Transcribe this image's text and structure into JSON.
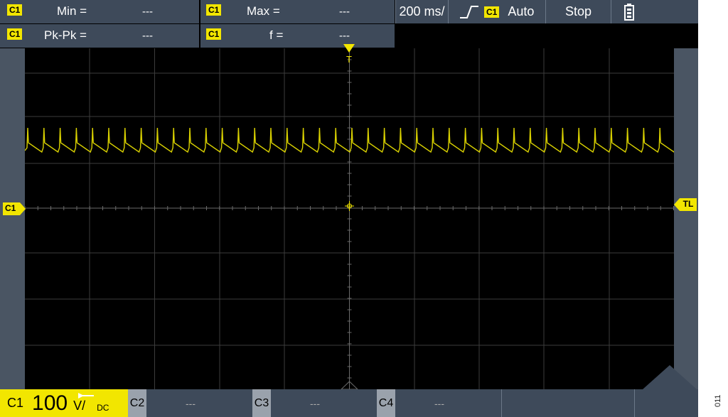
{
  "measurements": [
    {
      "channel": "C1",
      "label": "Min =",
      "value": "---"
    },
    {
      "channel": "C1",
      "label": "Max =",
      "value": "---"
    },
    {
      "channel": "C1",
      "label": "Pk-Pk =",
      "value": "---"
    },
    {
      "channel": "C1",
      "label": "f =",
      "value": "---"
    }
  ],
  "timebase": "200 ms/",
  "trigger": {
    "source": "C1",
    "mode": "Auto",
    "icon": "rising-edge-icon"
  },
  "run_state": "Stop",
  "battery_icon": "battery-icon",
  "markers": {
    "trigger_pos": "T",
    "channel_ref": "C1",
    "trigger_level": "TL"
  },
  "channels": [
    {
      "name": "C1",
      "scale": "100",
      "unit": "V/",
      "coupling": "DC",
      "active": true
    },
    {
      "name": "C2",
      "value": "---",
      "active": false
    },
    {
      "name": "C3",
      "value": "---",
      "active": false
    },
    {
      "name": "C4",
      "value": "---",
      "active": false
    }
  ],
  "side_label": "011",
  "colors": {
    "channel1": "#f2e600",
    "panel": "#3e4a5a",
    "background": "#000000"
  }
}
